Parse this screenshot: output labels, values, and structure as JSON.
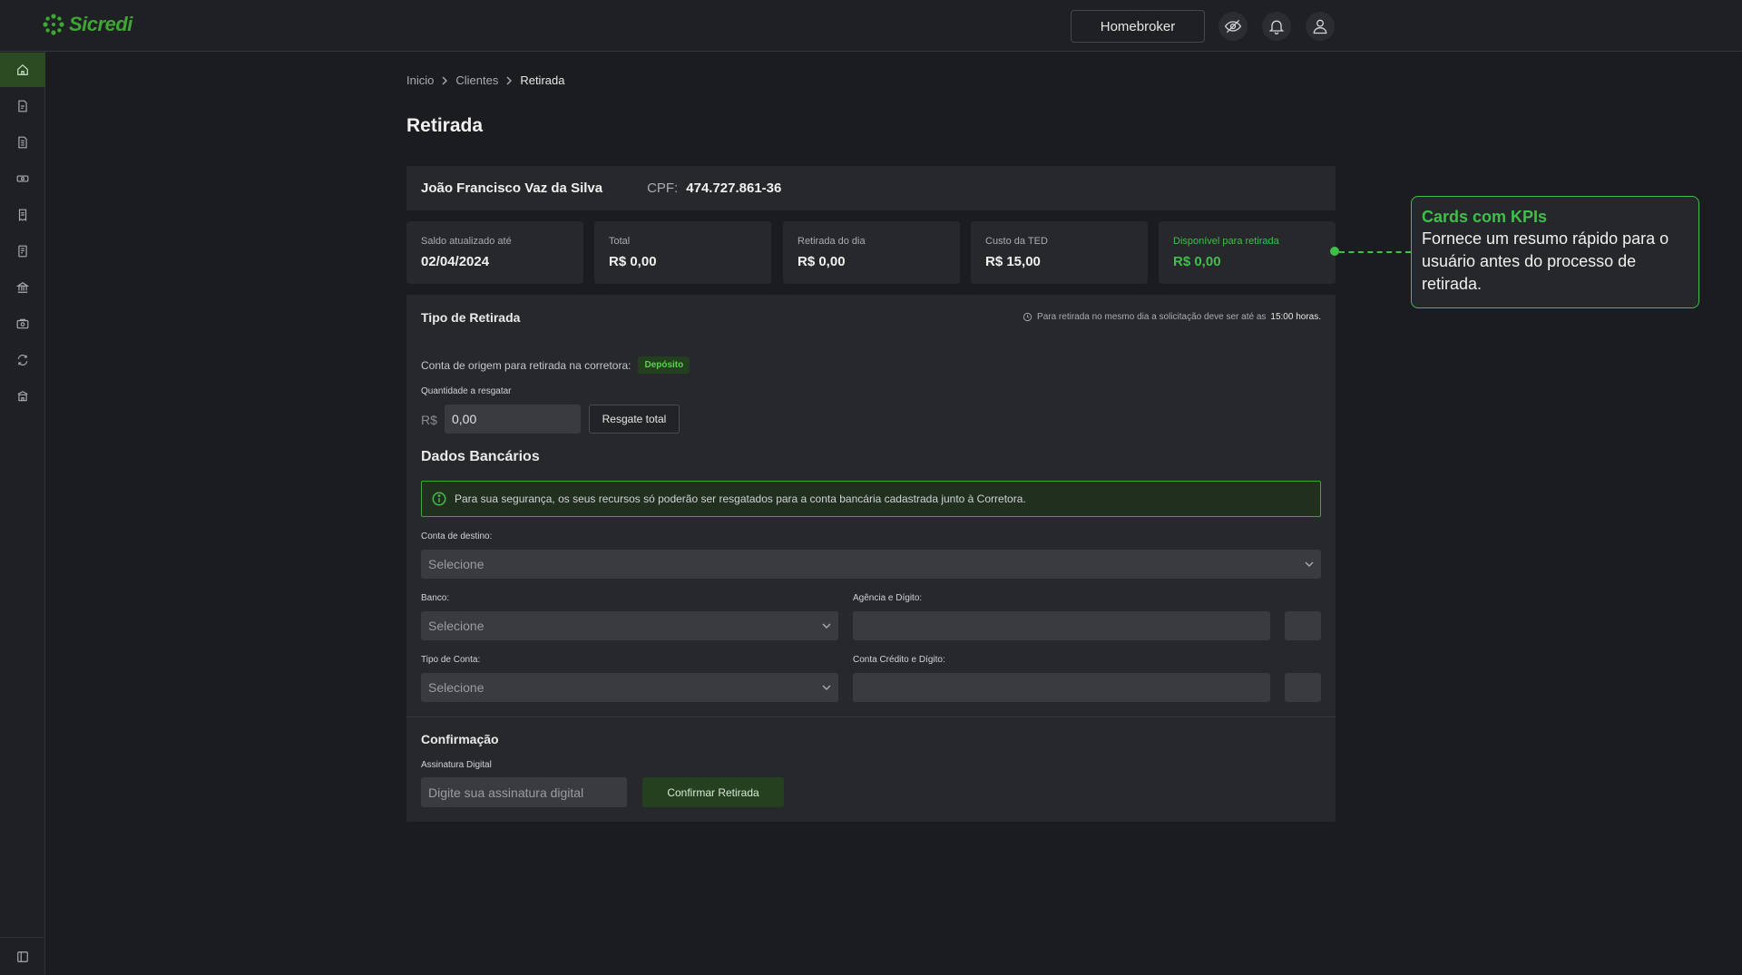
{
  "brand": {
    "name": "Sicredi",
    "color": "#3fa535"
  },
  "header": {
    "homebroker_label": "Homebroker",
    "icons": [
      "eye-off-icon",
      "bell-icon",
      "user-icon"
    ]
  },
  "sidebar": {
    "items": [
      "home-icon",
      "document-edit-icon",
      "document-icon",
      "money-icon",
      "receipt-icon",
      "report-icon",
      "bank-icon",
      "wallet-icon",
      "exchange-icon",
      "institution-icon"
    ],
    "active_index": 0,
    "bottom_icon": "sidebar-toggle-icon"
  },
  "breadcrumb": {
    "items": [
      "Inicio",
      "Clientes",
      "Retirada"
    ]
  },
  "page": {
    "title": "Retirada"
  },
  "client": {
    "name": "João Francisco Vaz da Silva",
    "cpf_label": "CPF:",
    "cpf": "474.727.861-36"
  },
  "kpis": [
    {
      "label": "Saldo atualizado até",
      "value": "02/04/2024"
    },
    {
      "label": "Total",
      "value": "R$ 0,00"
    },
    {
      "label": "Retirada do dia",
      "value": "R$ 0,00"
    },
    {
      "label": "Custo da TED",
      "value": "R$ 15,00"
    },
    {
      "label": "Disponível para retirada",
      "value": "R$ 0,00"
    }
  ],
  "withdrawal": {
    "title": "Tipo de Retirada",
    "note_prefix": "Para retirada no mesmo dia a solicitação deve ser até as",
    "note_time": "15:00 horas.",
    "origin_label": "Conta de origem para retirada na corretora:",
    "origin_badge": "Depósito",
    "amount_label": "Quantidade a resgatar",
    "currency": "R$",
    "amount_value": "0,00",
    "total_button": "Resgate total"
  },
  "bank": {
    "title": "Dados Bancários",
    "alert": "Para sua segurança, os seus recursos só poderão ser resgatados para a conta bancária cadastrada junto à Corretora.",
    "dest_label": "Conta de destino:",
    "dest_placeholder": "Selecione",
    "bank_label": "Banco:",
    "bank_placeholder": "Selecione",
    "agency_label": "Agência e Dígito:",
    "account_type_label": "Tipo de Conta:",
    "account_type_placeholder": "Selecione",
    "account_label": "Conta Crédito e Dígito:"
  },
  "confirmation": {
    "title": "Confirmação",
    "signature_label": "Assinatura Digital",
    "signature_placeholder": "Digite sua assinatura digital",
    "confirm_button": "Confirmar Retirada"
  },
  "annotation": {
    "title": "Cards com KPIs",
    "text": "Fornece um resumo rápido para o usuário antes do processo de retirada.",
    "color": "#3fbf4a"
  }
}
